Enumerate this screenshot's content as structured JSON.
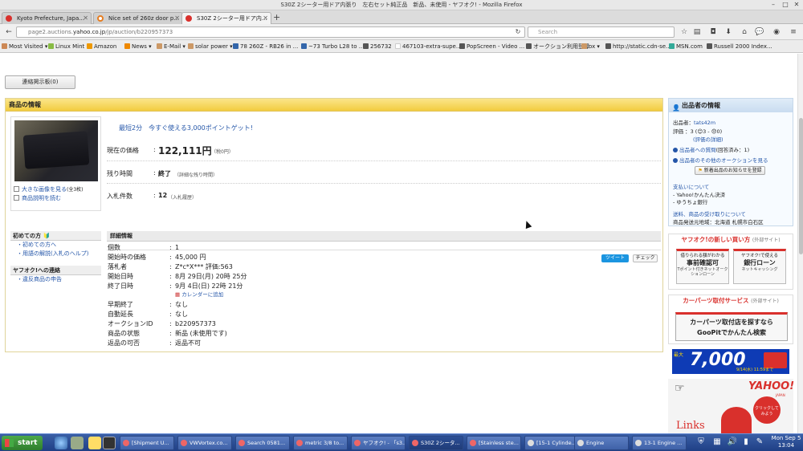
{
  "window": {
    "title": "S30Z 2シーター用ドア内張り　左右セット純正品　新品、未使用 - ヤフオク! - Mozilla Firefox"
  },
  "tabs": [
    {
      "label": "Kyoto Prefecture, Japa...",
      "active": false,
      "color": "#d9302c"
    },
    {
      "label": "Nice set of 260z door p...",
      "active": false,
      "color": "#e67e22"
    },
    {
      "label": "S30Z 2シーター用ドア内...",
      "active": true,
      "color": "#d9302c"
    }
  ],
  "nav": {
    "url_prefix": "page2.auctions.",
    "url_domain": "yahoo.co.jp",
    "url_path": "/jp/auction/b220957373",
    "search_placeholder": "Search"
  },
  "bookmarks": [
    "Most Visited ▾",
    "Linux Mint",
    "Amazon",
    "News ▾",
    "E-Mail ▾",
    "solar power ▾",
    "78 260Z - RB26 in ...",
    "~73 Turbo L28 to ...",
    "256732",
    "467103-extra-supe...",
    "PopScreen - Video ...",
    "オークション利用登録",
    "ox ▾",
    "http://static.cdn-se...",
    "MSN.com",
    "Russell 2000 Index..."
  ],
  "page": {
    "bbs_button": "連絡掲示板(0)",
    "section_title": "商品の情報",
    "image_links": {
      "large": "大きな画像を見る",
      "large_count": "(全3枚)",
      "desc": "商品説明を読む"
    },
    "promo": "最短2分　今すぐ使える3,000ポイントゲット!",
    "price_label": "現在の価格",
    "price_value": "122,111円",
    "price_note": "（税0円）",
    "time_label": "残り時間",
    "time_value": "終了",
    "time_link": "（詳細な残り時間）",
    "bids_label": "入札件数",
    "bids_value": "12",
    "bids_link": "（入札履歴）",
    "tweet": "ツイート",
    "check": "チェック"
  },
  "sidebar_left": {
    "beginner_title": "初めての方",
    "beginner_items": [
      "初めての方へ",
      "用語の解説(入札のヘルプ)"
    ],
    "contact_title": "ヤフオク!への連絡",
    "contact_items": [
      "違反商品の申告"
    ]
  },
  "details": {
    "title": "詳細情報",
    "rows": [
      {
        "k": "個数",
        "v": "1"
      },
      {
        "k": "開始時の価格",
        "v": "45,000 円"
      },
      {
        "k": "落札者",
        "v": "Z*c*X*** 評価:563"
      },
      {
        "k": "開始日時",
        "v": "8月 29日(月) 20時 25分"
      },
      {
        "k": "終了日時",
        "v": "9月 4日(日) 22時 21分"
      },
      {
        "k": "",
        "v": "カレンダーに追加"
      },
      {
        "k": "早期終了",
        "v": "なし"
      },
      {
        "k": "自動延長",
        "v": "なし"
      },
      {
        "k": "オークションID",
        "v": "b220957373"
      },
      {
        "k": "商品の状態",
        "v": "新品 (未使用です)"
      },
      {
        "k": "返品の可否",
        "v": "返品不可"
      }
    ]
  },
  "seller": {
    "title": "出品者の情報",
    "seller_label": "出品者：",
    "seller_name": "tats42m",
    "rating_label": "評価",
    "rating_value": "：3 (😊3 - 😞0)",
    "rating_link": "(評価の詳細)",
    "question_link": "出品者への質問",
    "question_note": "(回答済み：1)",
    "other_link": "出品者のその他のオークションを見る",
    "notify_button": "新着出品のお知らせを登録",
    "pay_title": "支払いについて",
    "pay_items": [
      "- Yahoo!かんたん決済",
      "- ゆうちょ銀行"
    ],
    "ship_title": "送料、商品の受け取りについて",
    "ship_from": "商品発送元地域：北海道 札幌市白石区"
  },
  "ad_buy": {
    "title": "ヤフオク!の新しい買い方",
    "title_note": "(外部サイト)",
    "card1": {
      "s": "借りられる額がわかる",
      "b": "事前確認可",
      "t": "Tポイント付きネットオークションローン"
    },
    "card2": {
      "s": "ヤフオク!で使える",
      "b": "銀行ローン",
      "t": "ネットキャッシング"
    }
  },
  "ad_parts": {
    "title": "カーパーツ取付サービス",
    "title_note": "(外部サイト)",
    "line1": "カーパーツ取付店を探すなら",
    "line2": "GooPitでかんたん検索"
  },
  "banner_t": {
    "big": "7,000",
    "small": "最大",
    "date": "9/14(水) 11:59まで"
  },
  "banner_y": {
    "logo": "YAHOO!",
    "sub": "JAPAN",
    "links": "Links",
    "click": "クリックしてみよう"
  },
  "taskbar": {
    "start": "start",
    "tasks": [
      "[Shipment U...",
      "VWVortex.co...",
      "Search 0581...",
      "metric 3/8 to...",
      "ヤフオク! - 「s3...",
      "S30Z 2シータ...",
      "[Stainless ste...",
      "[15-1 Cylinde...",
      "Engine",
      "13-1 Engine ..."
    ],
    "clock_day": "Mon Sep  5",
    "clock_time": "13:04"
  }
}
